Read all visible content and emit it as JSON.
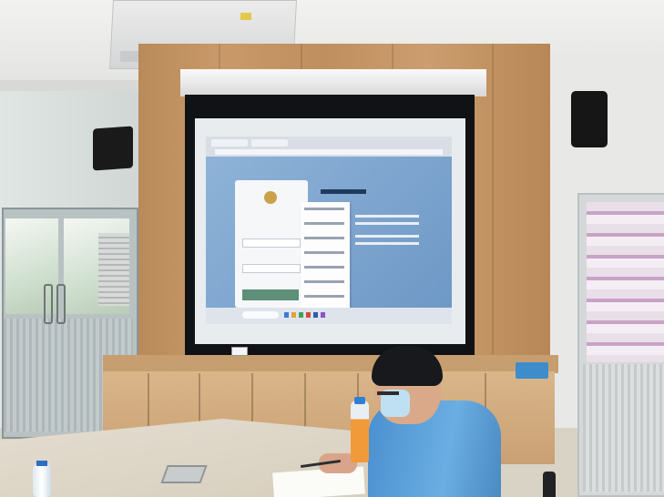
{
  "scene": {
    "type": "photo",
    "subject": "meeting-room-projection"
  }
}
